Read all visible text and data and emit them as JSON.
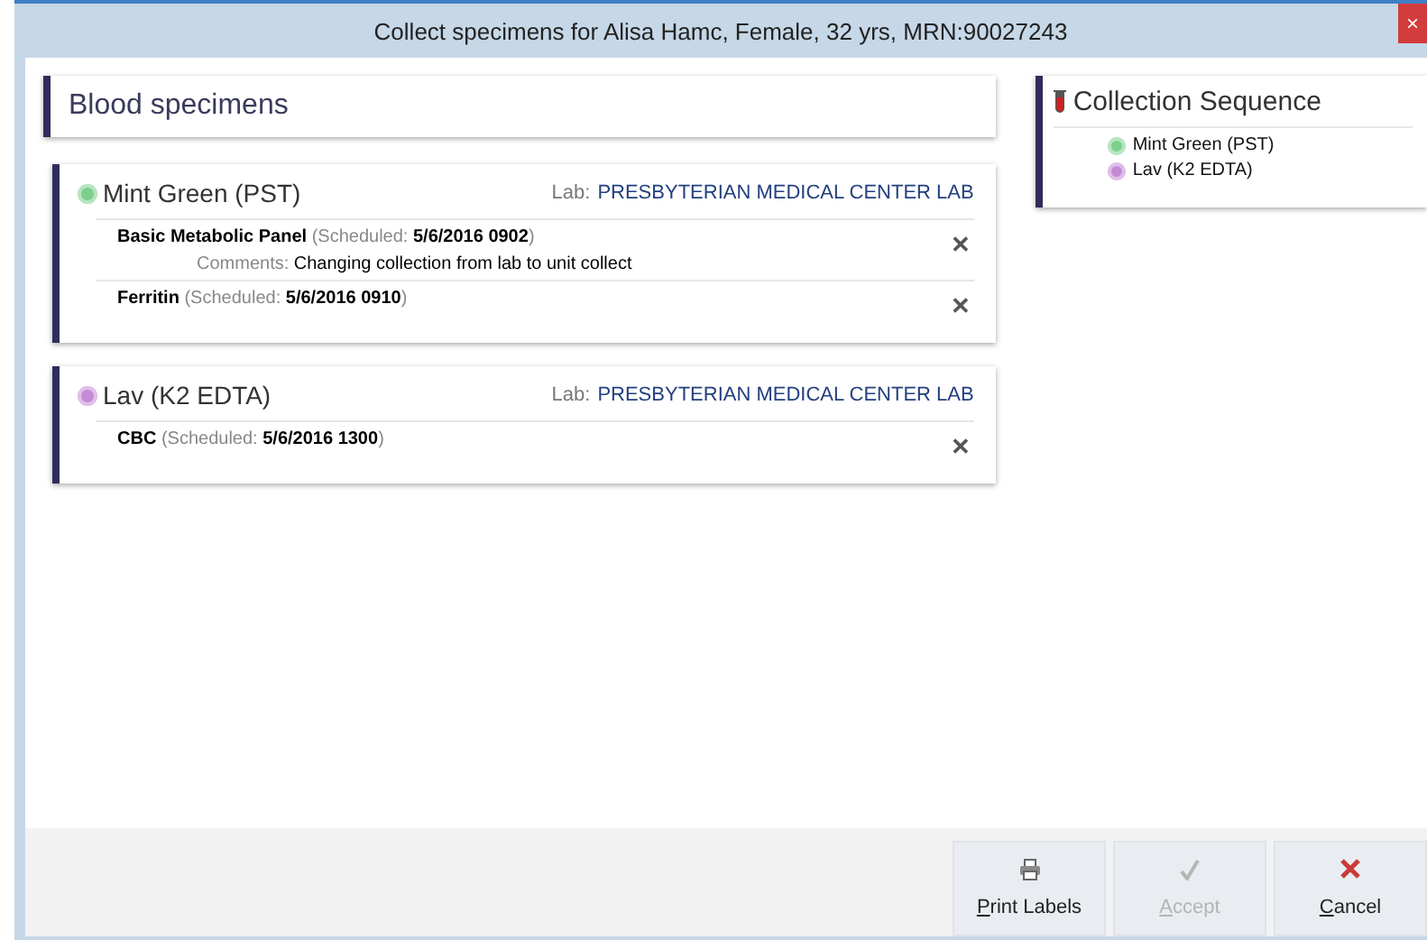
{
  "window": {
    "title": "Collect specimens for Alisa Hamc, Female, 32 yrs,  MRN:90027243",
    "close": "×"
  },
  "section": {
    "title": "Blood specimens"
  },
  "specimens": [
    {
      "container": "Mint Green (PST)",
      "color": "#7ccf8c",
      "lab_label": "Lab:",
      "lab": "PRESBYTERIAN MEDICAL CENTER LAB",
      "orders": [
        {
          "text": "**Basic Metabolic Panel** (Scheduled: **5/6/2016 0902**)",
          "comments_label": "Comments:",
          "comments": "Changing collection from lab to unit collect",
          "remove": "✕"
        },
        {
          "text": "**Ferritin** (Scheduled: **5/6/2016 0910**)",
          "remove": "✕"
        }
      ]
    },
    {
      "container": "Lav (K2 EDTA)",
      "color": "#c58ad6",
      "lab_label": "Lab:",
      "lab": "PRESBYTERIAN MEDICAL CENTER LAB",
      "orders": [
        {
          "text": "**CBC** (Scheduled: **5/6/2016 1300**)",
          "remove": "✕"
        }
      ]
    }
  ],
  "sequence": {
    "title": "Collection Sequence",
    "items": [
      {
        "label": "Mint Green (PST)",
        "color": "#7ccf8c"
      },
      {
        "label": "Lav (K2 EDTA)",
        "color": "#c58ad6"
      }
    ]
  },
  "buttons": [
    {
      "kind": "print",
      "label": "Print Labels",
      "disabled": false
    },
    {
      "kind": "accept",
      "label": "Accept",
      "disabled": true
    },
    {
      "kind": "cancel",
      "label": "Cancel",
      "disabled": false
    }
  ]
}
